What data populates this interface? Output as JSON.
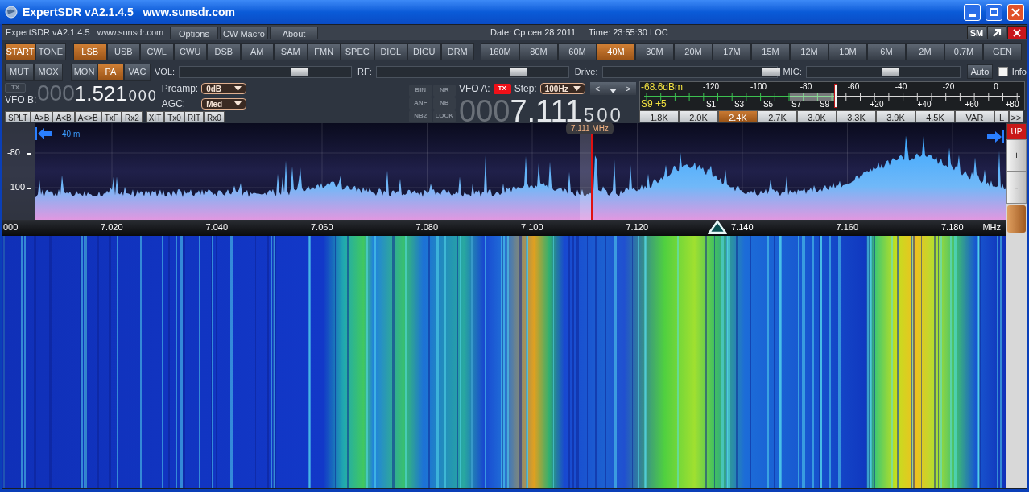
{
  "window": {
    "title": "ExpertSDR vA2.1.4.5   www.sunsdr.com"
  },
  "header": {
    "app_label": "ExpertSDR vA2.1.4.5   www.sunsdr.com",
    "menu": [
      "Options",
      "CW Macro",
      "About"
    ],
    "date": "Date: Ср сен 28 2011",
    "time": "Time: 23:55:30 LOC",
    "corner_buttons": [
      {
        "kind": "text",
        "label": "SM"
      },
      {
        "kind": "arrow"
      },
      {
        "kind": "close"
      }
    ]
  },
  "power_buttons": [
    {
      "label": "START",
      "selected": true
    },
    {
      "label": "TONE",
      "selected": false
    }
  ],
  "modes": [
    {
      "label": "LSB",
      "selected": true
    },
    {
      "label": "USB",
      "selected": false
    },
    {
      "label": "CWL",
      "selected": false
    },
    {
      "label": "CWU",
      "selected": false
    },
    {
      "label": "DSB",
      "selected": false
    },
    {
      "label": "AM",
      "selected": false
    },
    {
      "label": "SAM",
      "selected": false
    },
    {
      "label": "FMN",
      "selected": false
    },
    {
      "label": "SPEC",
      "selected": false
    },
    {
      "label": "DIGL",
      "selected": false
    },
    {
      "label": "DIGU",
      "selected": false
    },
    {
      "label": "DRM",
      "selected": false
    }
  ],
  "bands": [
    {
      "label": "160M",
      "selected": false
    },
    {
      "label": "80M",
      "selected": false
    },
    {
      "label": "60M",
      "selected": false
    },
    {
      "label": "40M",
      "selected": true
    },
    {
      "label": "30M",
      "selected": false
    },
    {
      "label": "20M",
      "selected": false
    },
    {
      "label": "17M",
      "selected": false
    },
    {
      "label": "15M",
      "selected": false
    },
    {
      "label": "12M",
      "selected": false
    },
    {
      "label": "10M",
      "selected": false
    },
    {
      "label": "6M",
      "selected": false
    },
    {
      "label": "2M",
      "selected": false
    },
    {
      "label": "0.7M",
      "selected": false
    },
    {
      "label": "GEN",
      "selected": false
    }
  ],
  "toggles_left": [
    {
      "label": "MUT",
      "selected": false
    },
    {
      "label": "MOX",
      "selected": false
    }
  ],
  "toggles_right": [
    {
      "label": "MON",
      "selected": false
    },
    {
      "label": "PA",
      "selected": true
    },
    {
      "label": "VAC",
      "selected": false
    }
  ],
  "sliders": [
    {
      "label": "VOL:",
      "level": 0.7
    },
    {
      "label": "RF:",
      "level": 0.74
    },
    {
      "label": "Drive:",
      "level": 0.97
    },
    {
      "label": "MIC:",
      "level": 0.55
    }
  ],
  "auto_button": "Auto",
  "info": {
    "label": "Info",
    "checked": false
  },
  "vfo_b": {
    "tx_label": "TX",
    "tx_on": false,
    "label": "VFO B:",
    "lead": "000",
    "main": "1.521",
    "tail": "000",
    "preamp_label": "Preamp:",
    "preamp": "0dB",
    "agc_label": "AGC:",
    "agc": "Med"
  },
  "vfo_b_buttons": [
    "SPLT",
    "A>B",
    "A<B",
    "A<>B",
    "TxF",
    "Rx2"
  ],
  "rit_buttons": [
    "XIT",
    "Tx0",
    "RIT",
    "Rx0"
  ],
  "dsp": [
    {
      "label": "BIN",
      "on": false
    },
    {
      "label": "NR",
      "on": false
    },
    {
      "label": "ANF",
      "on": false
    },
    {
      "label": "NB",
      "on": false
    },
    {
      "label": "NB2",
      "on": false
    },
    {
      "label": "LOCK",
      "on": false
    }
  ],
  "vfo_a": {
    "label": "VFO A:",
    "tx_label": "TX",
    "tx_on": true,
    "step_label": "Step:",
    "step": "100Hz",
    "step_buttons": [
      {
        "kind": "text",
        "label": "<"
      },
      {
        "kind": "down"
      },
      {
        "kind": "text",
        "label": ">"
      }
    ],
    "lead": "000",
    "main": "7.111",
    "tail": "500"
  },
  "meter": {
    "dbm": "-68.6dBm",
    "s_reading": "S9 +5",
    "top_labels": [
      "-120",
      "-100",
      "-80",
      "-60",
      "-40",
      "-20",
      "0"
    ],
    "bottom_labels": [
      "S1",
      "S3",
      "S5",
      "S7",
      "S9",
      "+20",
      "+40",
      "+60",
      "+80"
    ],
    "level": 0.51
  },
  "filters": [
    {
      "label": "1.8K",
      "selected": false
    },
    {
      "label": "2.0K",
      "selected": false
    },
    {
      "label": "2.4K",
      "selected": true
    },
    {
      "label": "2.7K",
      "selected": false
    },
    {
      "label": "3.0K",
      "selected": false
    },
    {
      "label": "3.3K",
      "selected": false
    },
    {
      "label": "3.9K",
      "selected": false
    },
    {
      "label": "4.5K",
      "selected": false
    },
    {
      "label": "VAR",
      "selected": false
    },
    {
      "label": "L",
      "selected": false
    },
    {
      "label": ">>",
      "selected": false
    }
  ],
  "spectrum": {
    "band_label": "40 m",
    "y_labels": [
      "-80",
      "-100"
    ],
    "cursor_label": "7.111 MHz",
    "up_button": "UP",
    "zoom_buttons": [
      "+",
      "-"
    ],
    "freq_labels": [
      "000",
      "7.020",
      "7.040",
      "7.060",
      "7.080",
      "7.100",
      "7.120",
      "7.140",
      "7.160",
      "7.180"
    ],
    "unit": "MHz"
  }
}
